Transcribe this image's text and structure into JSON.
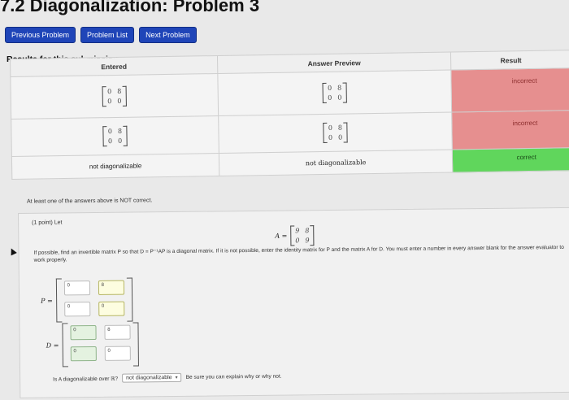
{
  "header": {
    "title": "7.2 Diagonalization: Problem 3"
  },
  "nav": {
    "previous": "Previous Problem",
    "list": "Problem List",
    "next": "Next Problem"
  },
  "results": {
    "heading": "Results for this submission",
    "columns": {
      "entered": "Entered",
      "preview": "Answer Preview",
      "result": "Result"
    },
    "rows": [
      {
        "entered": [
          [
            "0",
            "8"
          ],
          [
            "0",
            "0"
          ]
        ],
        "preview": [
          [
            "0",
            "8"
          ],
          [
            "0",
            "0"
          ]
        ],
        "result": "incorrect",
        "status_color": "#e68f8f"
      },
      {
        "entered": [
          [
            "0",
            "8"
          ],
          [
            "0",
            "0"
          ]
        ],
        "preview": [
          [
            "0",
            "8"
          ],
          [
            "0",
            "0"
          ]
        ],
        "result": "incorrect",
        "status_color": "#e68f8f"
      },
      {
        "entered_text": "not diagonalizable",
        "preview_text": "not diagonalizable",
        "result": "correct",
        "status_color": "#60d65c"
      }
    ],
    "warning": "At least one of the answers above is NOT correct."
  },
  "problem": {
    "points": "(1 point) Let",
    "matrix_label": "A =",
    "A": [
      [
        "9",
        "8"
      ],
      [
        "0",
        "9"
      ]
    ],
    "instructions": "If possible, find an invertible matrix P so that D = P⁻¹AP is a diagonal matrix. If it is not possible, enter the identity matrix for P and the matrix A for D. You must enter a number in every answer blank for the answer evaluator to work properly.",
    "P_label": "P =",
    "P": [
      [
        "0",
        "8"
      ],
      [
        "0",
        "0"
      ]
    ],
    "D_label": "D =",
    "D": [
      [
        "0",
        "8"
      ],
      [
        "0",
        "0"
      ]
    ],
    "question": "Is A diagonalizable over ℝ?",
    "answer_select": "not diagonalizable",
    "explain": "Be sure you can explain why or why not."
  },
  "colors": {
    "nav_button": "#1f45b8",
    "incorrect": "#e68f8f",
    "correct": "#60d65c"
  }
}
